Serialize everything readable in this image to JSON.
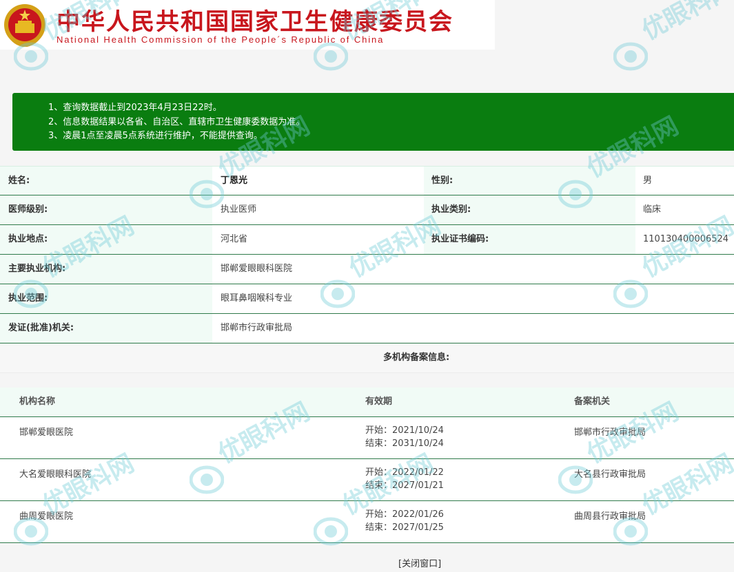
{
  "header": {
    "title_cn": "中华人民共和国国家卫生健康委员会",
    "title_en": "National Health Commission of the People´s Republic of China"
  },
  "notice": {
    "lines": [
      "1、查询数据截止到2023年4月23日22时。",
      "2、信息数据结果以各省、自治区、直辖市卫生健康委数据为准。",
      "3、凌晨1点至凌晨5点系统进行维护，不能提供查询。"
    ]
  },
  "info": {
    "name_label": "姓名:",
    "name": "丁恩光",
    "gender_label": "性别:",
    "gender": "男",
    "level_label": "医师级别:",
    "level": "执业医师",
    "category_label": "执业类别:",
    "category": "临床",
    "location_label": "执业地点:",
    "location": "河北省",
    "cert_label": "执业证书编码:",
    "cert": "110130400006524",
    "institution_label": "主要执业机构:",
    "institution": "邯郸爱眼眼科医院",
    "scope_label": "执业范围:",
    "scope": "眼耳鼻咽喉科专业",
    "authority_label": "发证(批准)机关:",
    "authority": "邯郸市行政审批局"
  },
  "multi": {
    "title": "多机构备案信息:",
    "headers": [
      "机构名称",
      "有效期",
      "备案机关"
    ],
    "rows": [
      {
        "name": "邯郸爱眼医院",
        "start": "开始：2021/10/24",
        "end": "结束：2031/10/24",
        "org": "邯郸市行政审批局"
      },
      {
        "name": "大名爱眼眼科医院",
        "start": "开始：2022/01/22",
        "end": "结束：2027/01/21",
        "org": "大名县行政审批局"
      },
      {
        "name": "曲周爱眼医院",
        "start": "开始：2022/01/26",
        "end": "结束：2027/01/25",
        "org": "曲周县行政审批局"
      }
    ]
  },
  "close_label": "[关闭窗口]",
  "watermark_text": "优眼科网",
  "colors": {
    "notice_bg": "#0a7d10",
    "title_red": "#c8161d",
    "row_border": "#2f7a4a",
    "watermark": "#6ecbd7"
  }
}
